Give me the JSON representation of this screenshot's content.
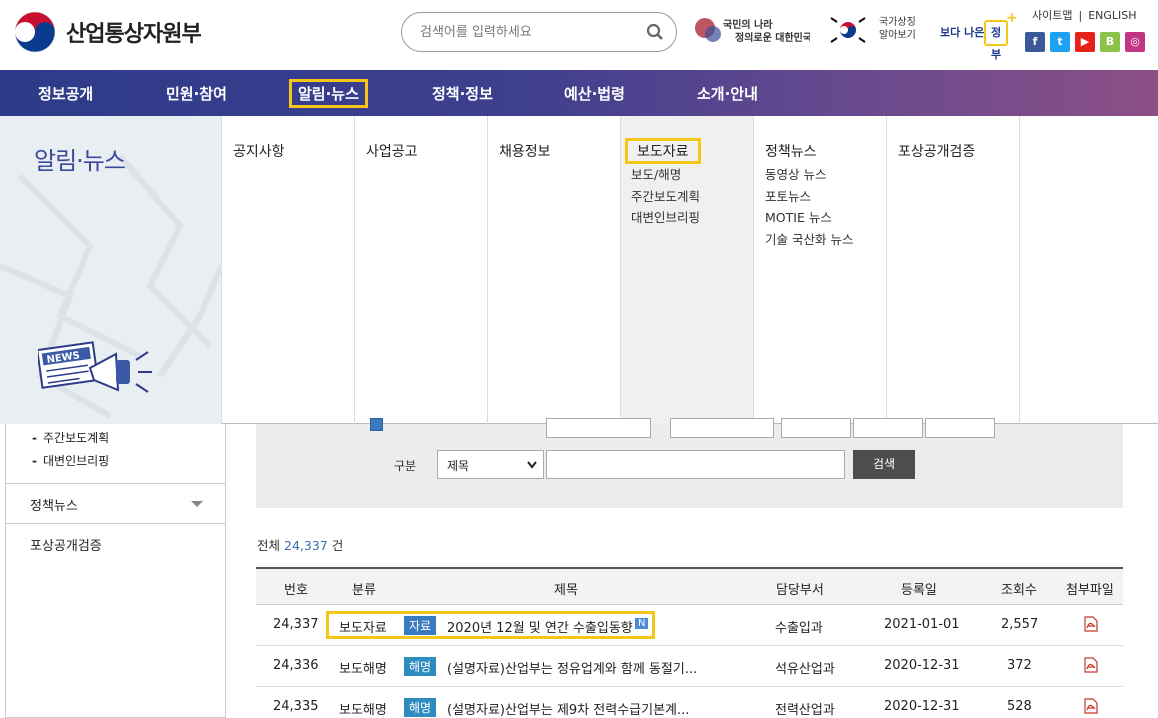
{
  "header": {
    "logo_text": "산업통상자원부",
    "search_placeholder": "검색어를 입력하세요",
    "banner1_text": "국민의 나라 정의로운 대한민국",
    "flag_text_line1": "국가상징",
    "flag_text_line2": "알아보기",
    "gov_logo_line1": "보다 나은",
    "gov_logo_line2": "정부",
    "sitemap": "사이트맵",
    "separator": "|",
    "english": "ENGLISH",
    "sns": [
      {
        "name": "facebook-icon",
        "glyph": "f",
        "color": "#3b5998"
      },
      {
        "name": "twitter-icon",
        "glyph": "t",
        "color": "#1da1f2"
      },
      {
        "name": "youtube-icon",
        "glyph": "▶",
        "color": "#e62117"
      },
      {
        "name": "blog-icon",
        "glyph": "B",
        "color": "#8bc34a"
      },
      {
        "name": "instagram-icon",
        "glyph": "◎",
        "color": "#c13584"
      }
    ]
  },
  "gnb": {
    "items": [
      "정보공개",
      "민원·참여",
      "알림·뉴스",
      "정책·정보",
      "예산·법령",
      "소개·안내"
    ],
    "active_index": 2
  },
  "mega": {
    "title": "알림·뉴스",
    "news_icon_text": "NEWS",
    "columns": [
      {
        "head": "공지사항",
        "subs": []
      },
      {
        "head": "사업공고",
        "subs": []
      },
      {
        "head": "채용정보",
        "subs": []
      },
      {
        "head": "보도자료",
        "subs": [
          "보도/해명",
          "주간보도계획",
          "대변인브리핑"
        ]
      },
      {
        "head": "정책뉴스",
        "subs": [
          "동영상 뉴스",
          "포토뉴스",
          "MOTIE 뉴스",
          "기술 국산화 뉴스"
        ]
      },
      {
        "head": "포상공개검증",
        "subs": []
      }
    ]
  },
  "sidebar": {
    "subs": [
      "주간보도계획",
      "대변인브리핑"
    ],
    "items": [
      "정책뉴스",
      "포상공개검증"
    ]
  },
  "search_form": {
    "type_label": "구분",
    "type_selected": "제목",
    "search_button": "검색"
  },
  "list": {
    "total_prefix": "전체",
    "total_count": "24,337",
    "total_suffix": "건",
    "columns": [
      "번호",
      "분류",
      "제목",
      "담당부서",
      "등록일",
      "조회수",
      "첨부파일"
    ],
    "rows": [
      {
        "no": "24,337",
        "category": "보도자료",
        "badge": "자료",
        "title": "2020년 12월 및 연간 수출입동향",
        "new": "N",
        "dept": "수출입과",
        "date": "2021-01-01",
        "views": "2,557"
      },
      {
        "no": "24,336",
        "category": "보도해명",
        "badge": "해명",
        "title": "(설명자료)산업부는 정유업계와 함께 동절기...",
        "new": "",
        "dept": "석유산업과",
        "date": "2020-12-31",
        "views": "372"
      },
      {
        "no": "24,335",
        "category": "보도해명",
        "badge": "해명",
        "title": "(설명자료)산업부는 제9차 전력수급기본계...",
        "new": "",
        "dept": "전력산업과",
        "date": "2020-12-31",
        "views": "528"
      }
    ]
  }
}
